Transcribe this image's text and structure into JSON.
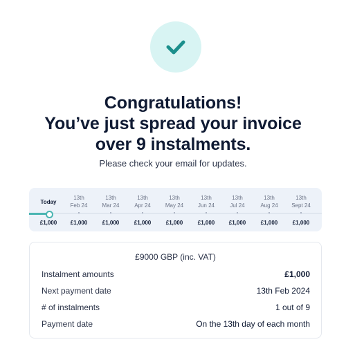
{
  "success": {
    "icon": "check-icon",
    "accent": "#1b8f8c",
    "badge_bg": "#d8f4f3"
  },
  "headline": {
    "line1": "Congratulations!",
    "line2": "You’ve just spread your invoice",
    "line3": "over 9 instalments."
  },
  "subline": "Please check your email for updates.",
  "timeline": {
    "progress": 0,
    "slots": [
      {
        "label": "Today",
        "day": "",
        "month": "",
        "amount": "£1,000"
      },
      {
        "label": "",
        "day": "13th",
        "month": "Feb 24",
        "amount": "£1,000"
      },
      {
        "label": "",
        "day": "13th",
        "month": "Mar 24",
        "amount": "£1,000"
      },
      {
        "label": "",
        "day": "13th",
        "month": "Apr 24",
        "amount": "£1,000"
      },
      {
        "label": "",
        "day": "13th",
        "month": "May 24",
        "amount": "£1,000"
      },
      {
        "label": "",
        "day": "13th",
        "month": "Jun 24",
        "amount": "£1,000"
      },
      {
        "label": "",
        "day": "13th",
        "month": "Jul 24",
        "amount": "£1,000"
      },
      {
        "label": "",
        "day": "13th",
        "month": "Aug 24",
        "amount": "£1,000"
      },
      {
        "label": "",
        "day": "13th",
        "month": "Sept 24",
        "amount": "£1,000"
      }
    ]
  },
  "summary": {
    "total": "£9000 GBP (inc. VAT)",
    "rows": [
      {
        "label": "Instalment amounts",
        "value": "£1,000"
      },
      {
        "label": "Next payment date",
        "value": "13th Feb 2024"
      },
      {
        "label": "# of instalments",
        "value": "1 out of 9"
      },
      {
        "label": "Payment date",
        "value": "On the 13th day of each month"
      }
    ]
  }
}
